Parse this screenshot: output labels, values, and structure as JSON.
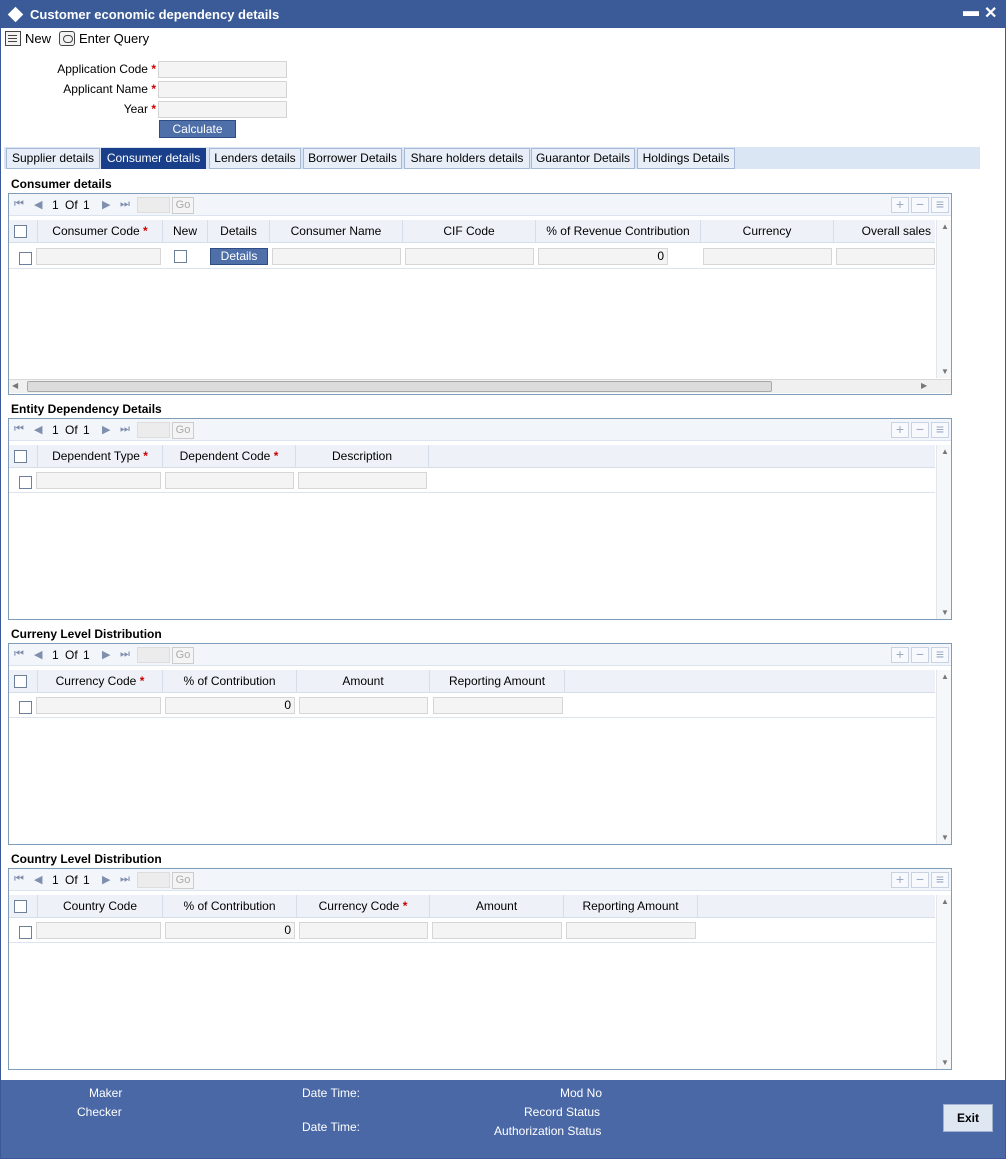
{
  "window": {
    "title": "Customer economic dependency details"
  },
  "toolbar": {
    "new_label": "New",
    "enter_query_label": "Enter Query"
  },
  "form": {
    "application_code_label": "Application Code",
    "applicant_name_label": "Applicant Name",
    "year_label": "Year",
    "required_mark": "*",
    "calculate_label": "Calculate"
  },
  "tabs": [
    "Supplier details",
    "Consumer details",
    "Lenders details",
    "Borrower Details",
    "Share holders details",
    "Guarantor Details",
    "Holdings Details"
  ],
  "active_tab": "Consumer details",
  "pager": {
    "page": "1",
    "of": "Of",
    "total": "1",
    "go": "Go"
  },
  "grid_buttons": {
    "add": "+",
    "remove": "−",
    "list": "≡"
  },
  "consumer": {
    "title": "Consumer details",
    "headers": [
      "Consumer Code",
      "New",
      "Details",
      "Consumer Name",
      "CIF Code",
      "% of Revenue Contribution",
      "Currency",
      "Overall sales"
    ],
    "details_button": "Details",
    "revenue_value": "0"
  },
  "entity": {
    "title": "Entity Dependency Details",
    "headers": [
      "Dependent Type",
      "Dependent Code",
      "Description"
    ]
  },
  "currency": {
    "title": "Curreny Level Distribution",
    "headers": [
      "Currency Code",
      "% of Contribution",
      "Amount",
      "Reporting Amount"
    ],
    "contribution_value": "0"
  },
  "country": {
    "title": "Country Level Distribution",
    "headers": [
      "Country Code",
      "% of Contribution",
      "Currency Code",
      "Amount",
      "Reporting Amount"
    ],
    "contribution_value": "0"
  },
  "footer": {
    "maker": "Maker",
    "checker": "Checker",
    "date_time": "Date Time:",
    "mod_no": "Mod No",
    "record_status": "Record Status",
    "authorization_status": "Authorization Status",
    "exit": "Exit"
  },
  "colors": {
    "title_bar": "#3a5a98",
    "footer": "#4a68a6",
    "active_tab": "#1a3f8a",
    "required": "#cc0000"
  }
}
